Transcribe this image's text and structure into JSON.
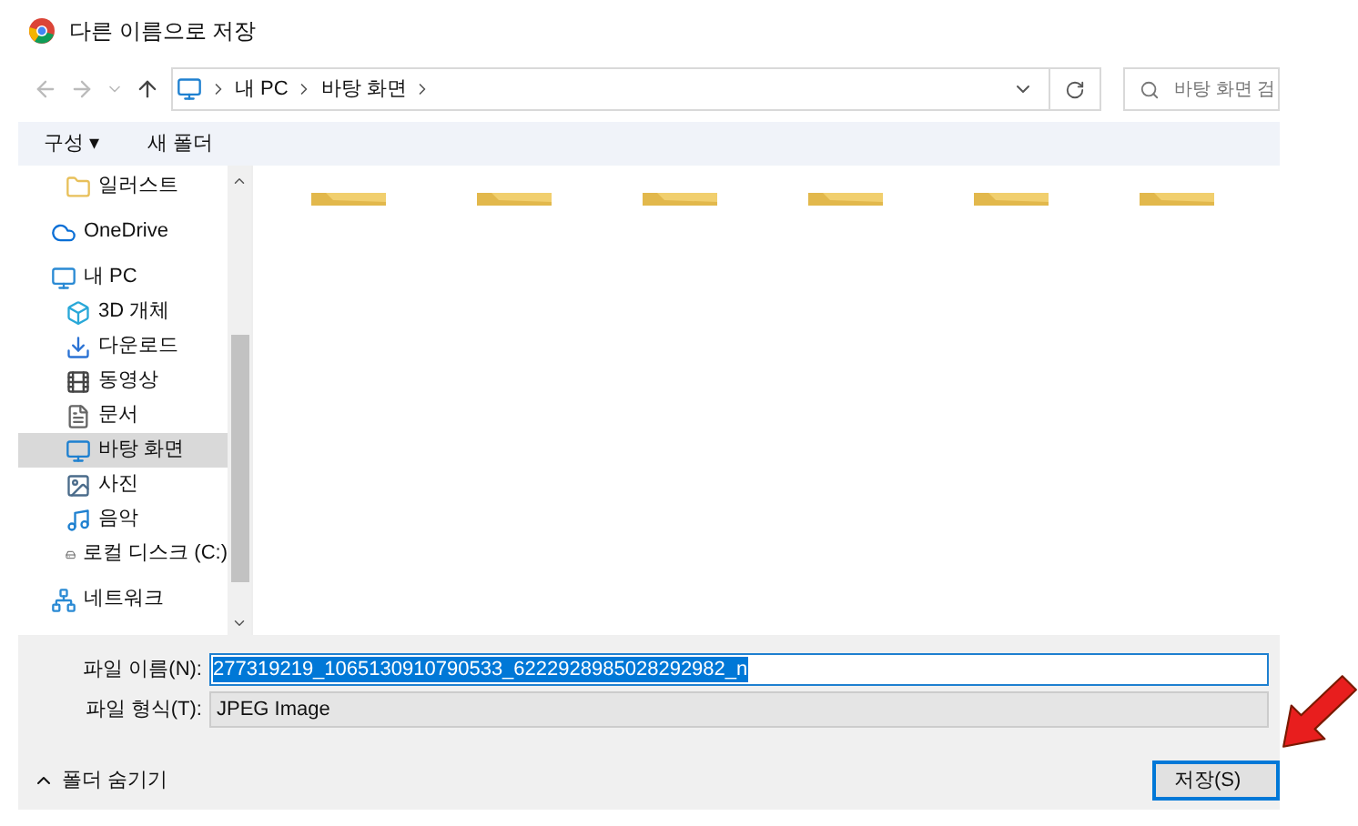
{
  "window": {
    "title": "다른 이름으로 저장"
  },
  "address_bar": {
    "path": [
      "내 PC",
      "바탕 화면"
    ]
  },
  "search": {
    "placeholder": "바탕 화면 검"
  },
  "toolbar": {
    "organize": "구성 ▾",
    "new_folder": "새 폴더"
  },
  "sidebar": {
    "items": [
      {
        "label": "일러스트",
        "kind": "folder",
        "selected": false
      },
      {
        "label": "OneDrive",
        "kind": "cloud",
        "selected": false
      },
      {
        "label": "내 PC",
        "kind": "pc",
        "selected": false,
        "children": [
          {
            "label": "3D 개체",
            "kind": "cube",
            "selected": false
          },
          {
            "label": "다운로드",
            "kind": "download",
            "selected": false
          },
          {
            "label": "동영상",
            "kind": "video",
            "selected": false
          },
          {
            "label": "문서",
            "kind": "document",
            "selected": false
          },
          {
            "label": "바탕 화면",
            "kind": "desktop",
            "selected": true
          },
          {
            "label": "사진",
            "kind": "image",
            "selected": false
          },
          {
            "label": "음악",
            "kind": "music",
            "selected": false
          },
          {
            "label": "로컬 디스크 (C:)",
            "kind": "drive",
            "selected": false
          }
        ]
      },
      {
        "label": "네트워크",
        "kind": "network",
        "selected": false
      }
    ]
  },
  "files": [
    {
      "kind": "folder"
    },
    {
      "kind": "folder"
    },
    {
      "kind": "folder"
    },
    {
      "kind": "folder"
    },
    {
      "kind": "folder"
    },
    {
      "kind": "folder"
    }
  ],
  "form": {
    "file_name_label": "파일 이름(N):",
    "file_name": "277319219_1065130910790533_6222928985028292982_n",
    "file_type_label": "파일 형식(T):",
    "file_type": "JPEG Image"
  },
  "footer": {
    "hide_folders": "폴더 숨기기",
    "save_button": "저장(S)"
  }
}
